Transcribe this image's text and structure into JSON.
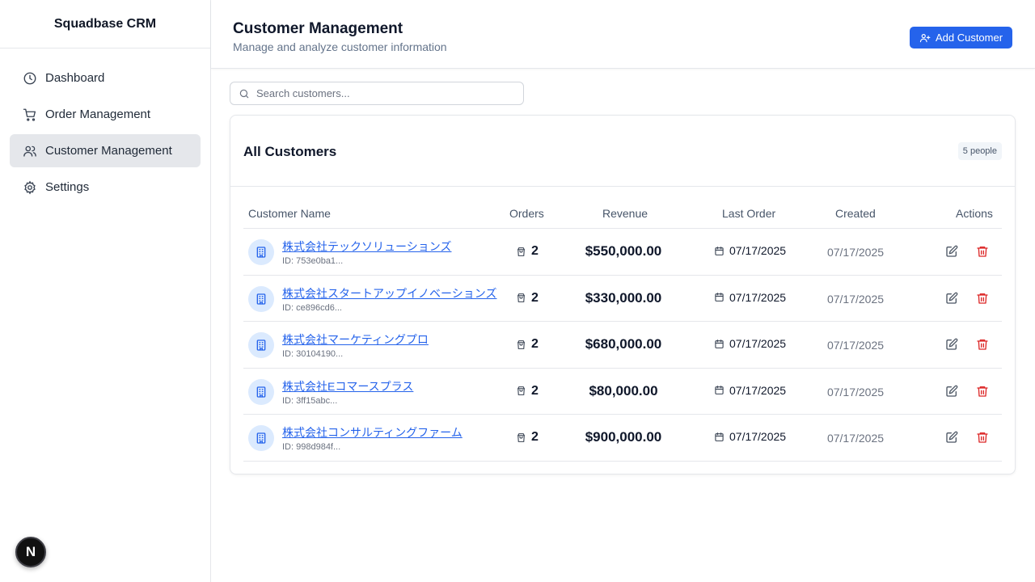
{
  "app": {
    "brand": "Squadbase CRM",
    "badge_letter": "N"
  },
  "sidebar": {
    "items": [
      {
        "label": "Dashboard",
        "icon": "clock-icon",
        "active": false
      },
      {
        "label": "Order Management",
        "icon": "cart-icon",
        "active": false
      },
      {
        "label": "Customer Management",
        "icon": "users-icon",
        "active": true
      },
      {
        "label": "Settings",
        "icon": "gear-icon",
        "active": false
      }
    ]
  },
  "header": {
    "title": "Customer Management",
    "subtitle": "Manage and analyze customer information",
    "add_button": "Add Customer"
  },
  "search": {
    "placeholder": "Search customers...",
    "value": ""
  },
  "card": {
    "title": "All Customers",
    "count": "5 people"
  },
  "table": {
    "columns": {
      "name": "Customer Name",
      "orders": "Orders",
      "revenue": "Revenue",
      "last_order": "Last Order",
      "created": "Created",
      "actions": "Actions"
    },
    "rows": [
      {
        "name": "株式会社テックソリューションズ",
        "id": "ID: 753e0ba1...",
        "orders": "2",
        "revenue": "$550,000.00",
        "last_order": "07/17/2025",
        "created": "07/17/2025"
      },
      {
        "name": "株式会社スタートアップイノベーションズ",
        "id": "ID: ce896cd6...",
        "orders": "2",
        "revenue": "$330,000.00",
        "last_order": "07/17/2025",
        "created": "07/17/2025"
      },
      {
        "name": "株式会社マーケティングプロ",
        "id": "ID: 30104190...",
        "orders": "2",
        "revenue": "$680,000.00",
        "last_order": "07/17/2025",
        "created": "07/17/2025"
      },
      {
        "name": "株式会社Eコマースプラス",
        "id": "ID: 3ff15abc...",
        "orders": "2",
        "revenue": "$80,000.00",
        "last_order": "07/17/2025",
        "created": "07/17/2025"
      },
      {
        "name": "株式会社コンサルティングファーム",
        "id": "ID: 998d984f...",
        "orders": "2",
        "revenue": "$900,000.00",
        "last_order": "07/17/2025",
        "created": "07/17/2025"
      }
    ]
  },
  "colors": {
    "accent": "#2563eb",
    "danger": "#dc2626",
    "active_nav": "#e5e7eb"
  }
}
